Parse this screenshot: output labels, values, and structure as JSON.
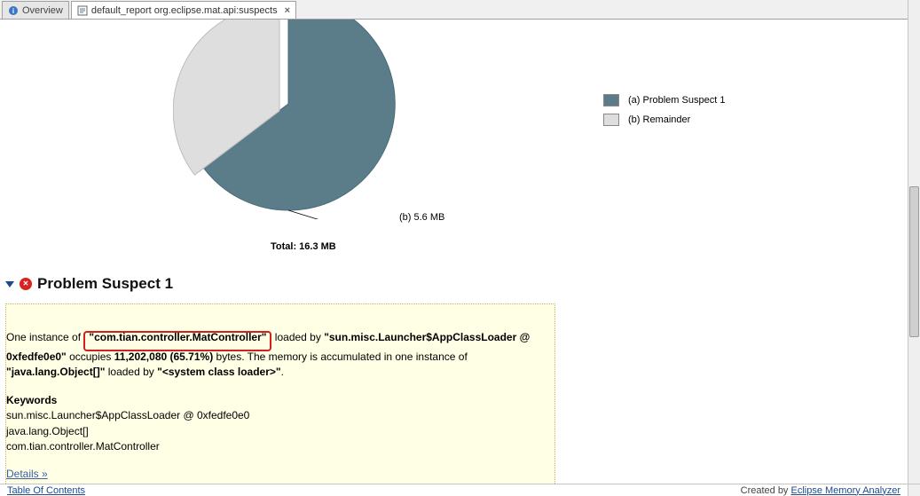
{
  "tabs": {
    "overview": "Overview",
    "report": "default_report org.eclipse.mat.api:suspects"
  },
  "chart_data": {
    "type": "pie",
    "title": "",
    "total_label": "Total: 16.3 MB",
    "slices": [
      {
        "key": "a",
        "label": "(a) Problem Suspect 1",
        "value_mb": 10.7,
        "color": "#5b7d8a"
      },
      {
        "key": "b",
        "label": "(b) Remainder",
        "value_mb": 5.6,
        "color": "#dedede"
      }
    ],
    "slice_b_annotation": "(b) 5.6 MB"
  },
  "legend": {
    "a": "(a) Problem Suspect 1",
    "b": "(b) Remainder"
  },
  "section": {
    "title": "Problem Suspect 1"
  },
  "info": {
    "p1_pre": "One instance of ",
    "p1_hl": "\"com.tian.controller.MatController\"",
    "p1_mid1": " loaded by ",
    "p1_loader": "\"sun.misc.Launcher$AppClassLoader @ 0xfedfe0e0\"",
    "p1_mid2": " occupies ",
    "p1_bytes": "11,202,080 (65.71%)",
    "p1_mid3": " bytes. The memory is accumulated in one instance of ",
    "p1_obj": "\"java.lang.Object[]\"",
    "p1_mid4": " loaded by ",
    "p1_sys": "\"<system class loader>\"",
    "p1_end": ".",
    "kw_head": "Keywords",
    "kw1": "sun.misc.Launcher$AppClassLoader @ 0xfedfe0e0",
    "kw2": "java.lang.Object[]",
    "kw3": "com.tian.controller.MatController",
    "details": "Details »"
  },
  "footer": {
    "toc": "Table Of Contents",
    "credit_pre": "Created by ",
    "credit_link": "Eclipse Memory Analyzer"
  }
}
